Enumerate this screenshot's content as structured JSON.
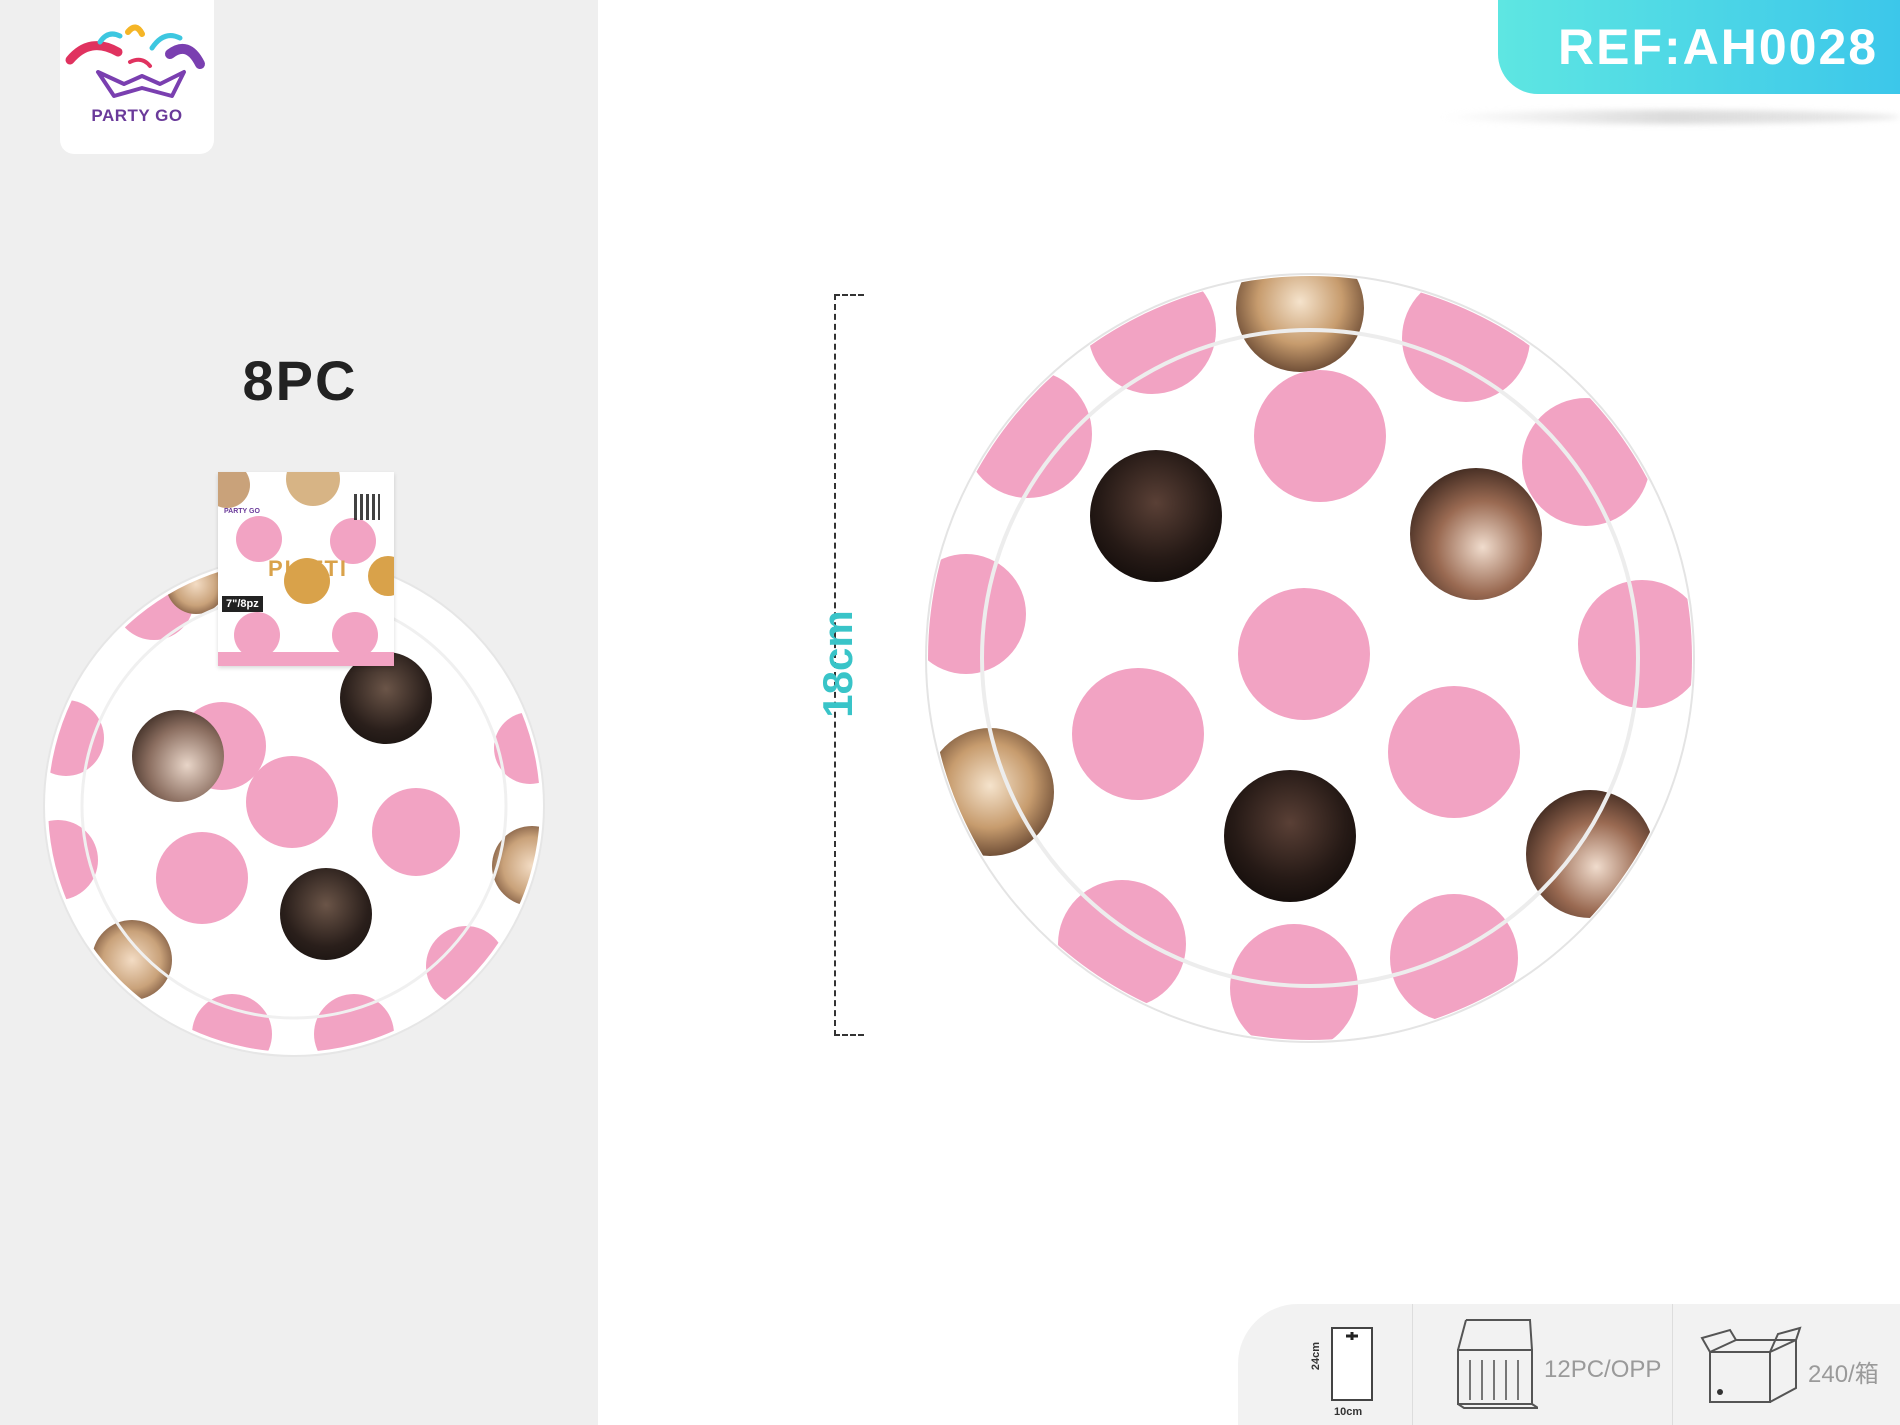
{
  "brand": {
    "name": "PARTY GO"
  },
  "ref": {
    "label": "REF:AH0028"
  },
  "product": {
    "quantity": "8PC",
    "package_title": "PIATTI",
    "package_size": "7\"/8pz",
    "dimension": "18cm"
  },
  "packing": {
    "pack_height": "24cm",
    "pack_width": "10cm",
    "inner_pack": "12PC/OPP",
    "carton": "240/箱"
  },
  "colors": {
    "pink": "#f2a3c3",
    "gold": "#c9a27a",
    "dark_gold": "#3a2a22",
    "teal_accent": "#39c4c8"
  }
}
